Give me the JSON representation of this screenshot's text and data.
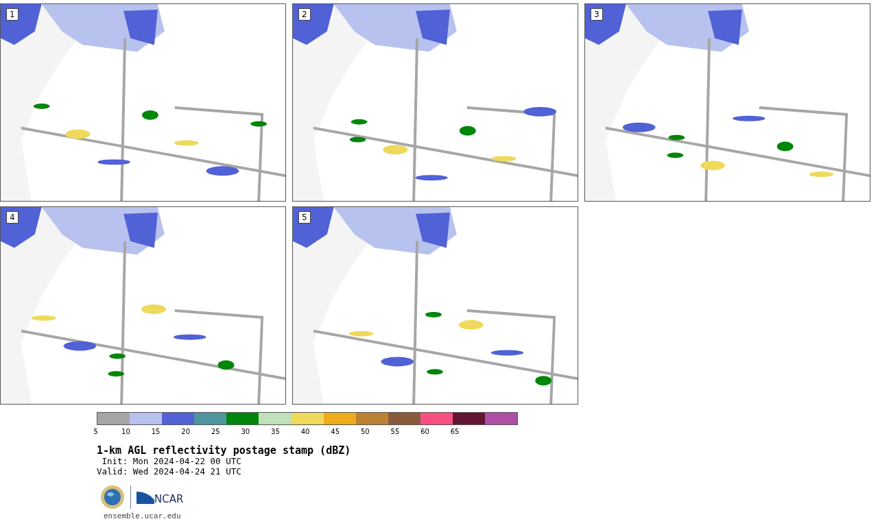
{
  "panels": [
    {
      "label": "1"
    },
    {
      "label": "2"
    },
    {
      "label": "3"
    },
    {
      "label": "4"
    },
    {
      "label": "5"
    }
  ],
  "colorbar": {
    "segments": [
      {
        "color": "#a6a6a6"
      },
      {
        "color": "#b8c2ee"
      },
      {
        "color": "#5161d6"
      },
      {
        "color": "#4e969e"
      },
      {
        "color": "#00860a"
      },
      {
        "color": "#bfdfbd"
      },
      {
        "color": "#efd95b"
      },
      {
        "color": "#efac1a"
      },
      {
        "color": "#bc8233"
      },
      {
        "color": "#8a5a3d"
      },
      {
        "color": "#f55080"
      },
      {
        "color": "#631634"
      },
      {
        "color": "#ad4fa5"
      }
    ],
    "ticks": [
      "5",
      "10",
      "15",
      "20",
      "25",
      "30",
      "35",
      "40",
      "45",
      "50",
      "55",
      "60",
      "65"
    ]
  },
  "title": "1-km AGL reflectivity postage stamp (dBZ)",
  "init": " Init: Mon 2024-04-22 00 UTC",
  "valid": "Valid: Wed 2024-04-24 21 UTC",
  "logo_text": "NCAR",
  "url": "ensemble.ucar.edu"
}
